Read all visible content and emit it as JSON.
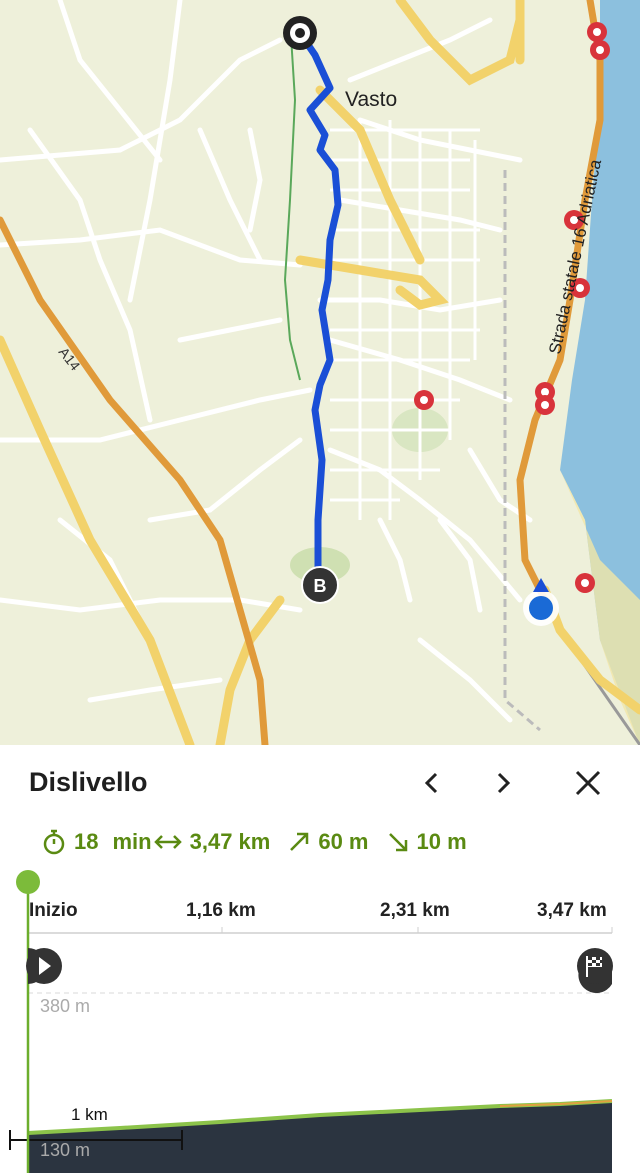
{
  "map": {
    "city_label": "Vasto",
    "road_a14": "A14",
    "road_ss16": "Strada statale 16 Adriatica",
    "marker_b": "B"
  },
  "panel": {
    "title": "Dislivello",
    "stats": {
      "time_value": "18",
      "time_unit": "min",
      "distance": "3,47 km",
      "ascent": "60 m",
      "descent": "10 m"
    },
    "axis_labels": [
      "Inizio",
      "1,16 km",
      "2,31 km",
      "3,47 km"
    ],
    "elev_top": "380 m",
    "elev_bottom": "130 m",
    "scale_label": "1 km"
  },
  "colors": {
    "accent_green": "#5a8a12",
    "route_blue": "#1a4fd6",
    "poi_red": "#d8333b",
    "sea": "#7fb6d9"
  },
  "icons": [
    "stopwatch-icon",
    "distance-icon",
    "ascent-icon",
    "descent-icon",
    "chevron-left-icon",
    "chevron-right-icon",
    "close-icon",
    "play-icon",
    "finish-flag-icon"
  ]
}
